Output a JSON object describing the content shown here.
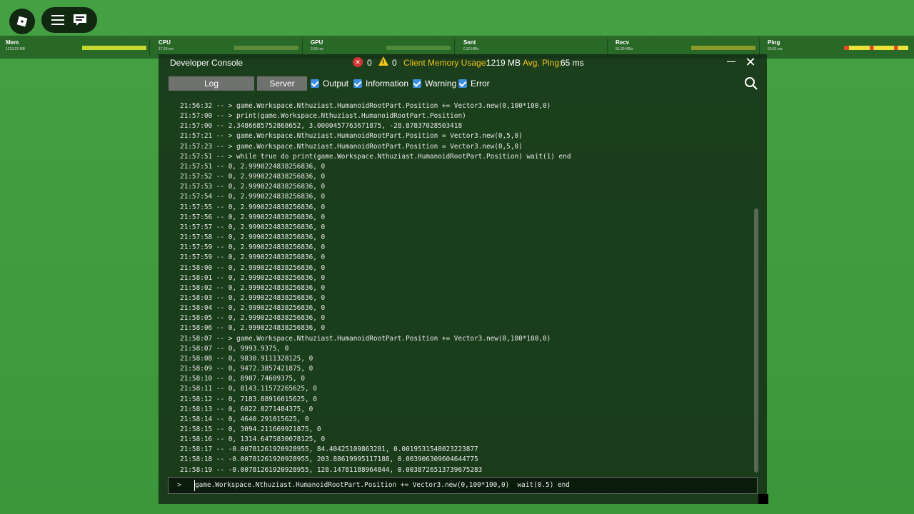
{
  "colors": {
    "background": "#3f9a3e",
    "accent_yellow": "#f0c419",
    "checkbox_blue": "#3b8ee0",
    "error_red": "#d13636"
  },
  "topbar": {
    "roblox_icon": "roblox-logo-icon",
    "menu_icon": "hamburger-icon",
    "chat_icon": "chat-icon"
  },
  "stats": [
    {
      "label": "Mem",
      "value": "1219.23 MB",
      "fill": 1.0
    },
    {
      "label": "CPU",
      "value": "17.10 ms",
      "fill": 1.0
    },
    {
      "label": "GPU",
      "value": "2.66 ms",
      "fill": 1.0
    },
    {
      "label": "Sent",
      "value": "0.30 KB/s",
      "fill": 1.0
    },
    {
      "label": "Recv",
      "value": "56.20 KB/s",
      "fill": 1.0
    },
    {
      "label": "Ping",
      "value": "60.81 ms",
      "fill": 1.0
    }
  ],
  "console": {
    "title": "Developer Console",
    "error_count": "0",
    "warning_count": "0",
    "memory_label": "Client Memory Usage:",
    "memory_value": "1219 MB",
    "ping_label": "Avg. Ping:",
    "ping_value": "65 ms",
    "tabs": {
      "log": "Log",
      "server": "Server"
    },
    "filters": {
      "output": "Output",
      "information": "Information",
      "warning": "Warning",
      "error": "Error"
    },
    "log_lines": [
      "21:56:32 -- > game.Workspace.Nthuziast.HumanoidRootPart.Position += Vector3.new(0,100*100,0)",
      "21:57:00 -- > print(game.Workspace.Nthuziast.HumanoidRootPart.Position)",
      "21:57:00 -- 2.3486685752868652, 3.0000457763671875, -28.87837028503418",
      "21:57:21 -- > game.Workspace.Nthuziast.HumanoidRootPart.Position = Vector3.new(0,5,0)",
      "21:57:23 -- > game.Workspace.Nthuziast.HumanoidRootPart.Position = Vector3.new(0,5,0)",
      "21:57:51 -- > while true do print(game.Workspace.Nthuziast.HumanoidRootPart.Position) wait(1) end",
      "21:57:51 -- 0, 2.9990224838256836, 0",
      "21:57:52 -- 0, 2.9990224838256836, 0",
      "21:57:53 -- 0, 2.9990224838256836, 0",
      "21:57:54 -- 0, 2.9990224838256836, 0",
      "21:57:55 -- 0, 2.9990224838256836, 0",
      "21:57:56 -- 0, 2.9990224838256836, 0",
      "21:57:57 -- 0, 2.9990224838256836, 0",
      "21:57:58 -- 0, 2.9990224838256836, 0",
      "21:57:59 -- 0, 2.9990224838256836, 0",
      "21:57:59 -- 0, 2.9990224838256836, 0",
      "21:58:00 -- 0, 2.9990224838256836, 0",
      "21:58:01 -- 0, 2.9990224838256836, 0",
      "21:58:02 -- 0, 2.9990224838256836, 0",
      "21:58:03 -- 0, 2.9990224838256836, 0",
      "21:58:04 -- 0, 2.9990224838256836, 0",
      "21:58:05 -- 0, 2.9990224838256836, 0",
      "21:58:06 -- 0, 2.9990224838256836, 0",
      "21:58:07 -- > game.Workspace.Nthuziast.HumanoidRootPart.Position += Vector3.new(0,100*100,0)",
      "21:58:07 -- 0, 9993.9375, 0",
      "21:58:08 -- 0, 9830.9111328125, 0",
      "21:58:09 -- 0, 9472.3857421875, 0",
      "21:58:10 -- 0, 8907.74609375, 0",
      "21:58:11 -- 0, 8143.11572265625, 0",
      "21:58:12 -- 0, 7183.88916015625, 0",
      "21:58:13 -- 0, 6022.8271484375, 0",
      "21:58:14 -- 0, 4640.291015625, 0",
      "21:58:15 -- 0, 3094.211669921875, 0",
      "21:58:16 -- 0, 1314.6475830078125, 0",
      "21:58:17 -- -0.00781261920928955, 84.40425109863281, 0.0019531548023223877",
      "21:58:18 -- -0.00781261920928955, 203.88619995117188, 0.003906309604644775",
      "21:58:19 -- -0.00781261920928955, 128.14781188964844, 0.0038726513739675283"
    ],
    "command_prompt": ">",
    "command_value": "game.Workspace.Nthuziast.HumanoidRootPart.Position += Vector3.new(0,100*100,0)  wait(0.5) end"
  }
}
